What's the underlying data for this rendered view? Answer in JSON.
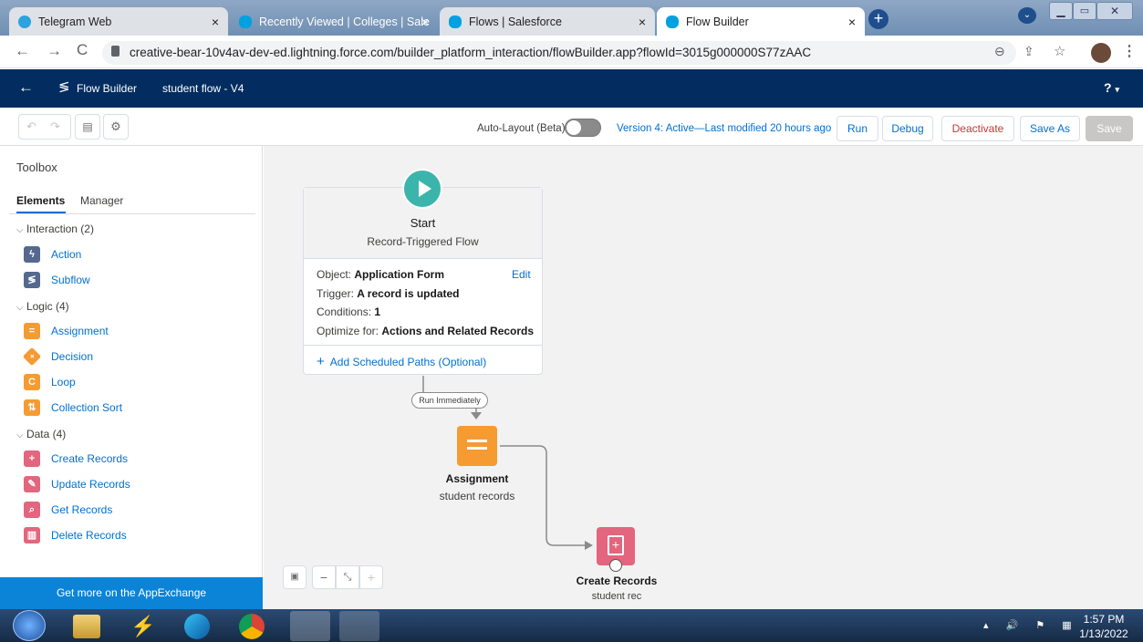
{
  "browser": {
    "tabs": [
      {
        "label": "Telegram Web",
        "icon": "telegram-icon",
        "color": "#2aa3df"
      },
      {
        "label": "Recently Viewed | Colleges | Sale",
        "icon": "salesforce-cloud-icon",
        "color": "#00a1e0"
      },
      {
        "label": "Flows | Salesforce",
        "icon": "salesforce-cloud-icon",
        "color": "#00a1e0"
      },
      {
        "label": "Flow Builder",
        "icon": "salesforce-cloud-icon",
        "color": "#00a1e0"
      }
    ],
    "close_glyph": "×",
    "new_tab_glyph": "+",
    "url": "creative-bear-10v4av-dev-ed.lightning.force.com/builder_platform_interaction/flowBuilder.app?flowId=3015g000000S77zAAC"
  },
  "app_header": {
    "product": "Flow Builder",
    "flow_name": "student flow - V4",
    "help": "?"
  },
  "toolbar": {
    "auto_layout_label": "Auto-Layout (Beta)",
    "version_status": "Version 4: Active—Last modified 20 hours ago",
    "run": "Run",
    "debug": "Debug",
    "deactivate": "Deactivate",
    "save_as": "Save As",
    "save": "Save"
  },
  "toolbox": {
    "title": "Toolbox",
    "tabs": [
      "Elements",
      "Manager"
    ],
    "sections": [
      {
        "label": "Interaction (2)",
        "items": [
          {
            "label": "Action",
            "icon": "lightning-icon",
            "color": "#54698d"
          },
          {
            "label": "Subflow",
            "icon": "subflow-icon",
            "color": "#54698d"
          }
        ]
      },
      {
        "label": "Logic (4)",
        "items": [
          {
            "label": "Assignment",
            "icon": "equals-icon",
            "color": "#f59b32"
          },
          {
            "label": "Decision",
            "icon": "diamond-icon",
            "color": "#f59b32"
          },
          {
            "label": "Loop",
            "icon": "loop-icon",
            "color": "#f59b32"
          },
          {
            "label": "Collection Sort",
            "icon": "sort-icon",
            "color": "#f59b32"
          }
        ]
      },
      {
        "label": "Data (4)",
        "items": [
          {
            "label": "Create Records",
            "icon": "record-create-icon",
            "color": "#e3657e"
          },
          {
            "label": "Update Records",
            "icon": "record-update-icon",
            "color": "#e3657e"
          },
          {
            "label": "Get Records",
            "icon": "record-lookup-icon",
            "color": "#e3657e"
          },
          {
            "label": "Delete Records",
            "icon": "record-delete-icon",
            "color": "#e3657e"
          }
        ]
      }
    ],
    "footer": "Get more on the AppExchange"
  },
  "canvas": {
    "start": {
      "title": "Start",
      "subtitle": "Record-Triggered Flow",
      "object_label": "Object:",
      "object_value": "Application Form",
      "edit": "Edit",
      "trigger_label": "Trigger:",
      "trigger_value": "A record is updated",
      "conditions_label": "Conditions:",
      "conditions_value": "1",
      "optimize_label": "Optimize for:",
      "optimize_value": "Actions and Related Records",
      "add_paths": "Add Scheduled Paths (Optional)"
    },
    "connector_label": "Run Immediately",
    "assignment": {
      "title": "Assignment",
      "subtitle": "student records"
    },
    "create_records": {
      "title": "Create Records",
      "subtitle": "student rec"
    }
  },
  "taskbar": {
    "time": "1:57 PM",
    "date": "1/13/2022"
  },
  "colors": {
    "header": "#032d60",
    "brand_blue": "#0070d2",
    "deactivate_red": "#c23934",
    "start_teal": "#3bb5ab",
    "assignment_orange": "#f59b32",
    "records_pink": "#e3657e",
    "appexchange_blue": "#0b84d8"
  }
}
